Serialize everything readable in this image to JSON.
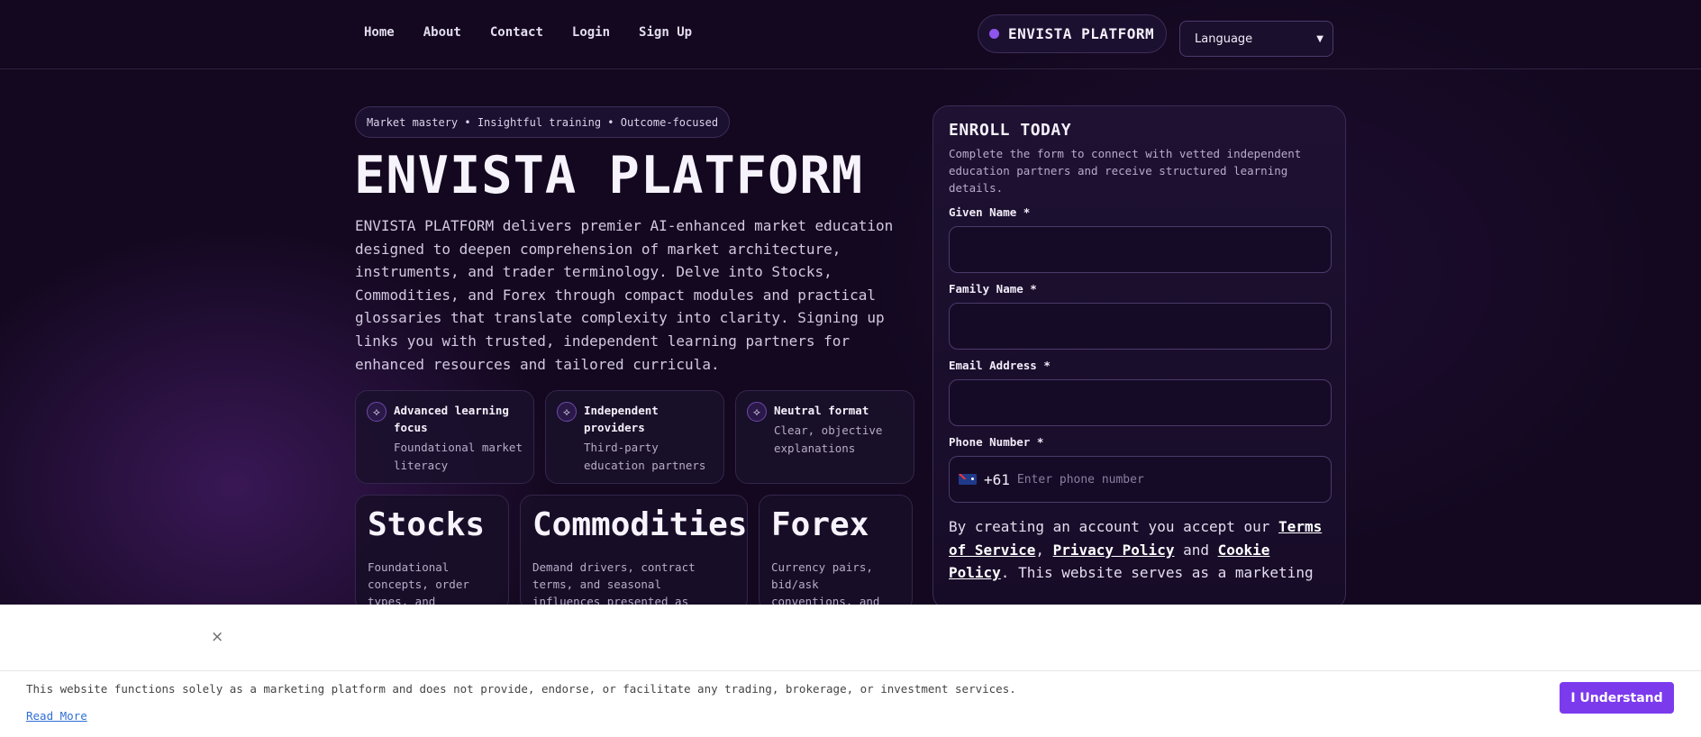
{
  "nav": {
    "items": [
      "Home",
      "About",
      "Contact",
      "Login",
      "Sign Up"
    ],
    "brand": "ENVISTA PLATFORM",
    "language_label": "Language"
  },
  "hero": {
    "tagline": "Market mastery • Insightful training • Outcome-focused",
    "title": "ENVISTA PLATFORM",
    "description": "ENVISTA PLATFORM delivers premier AI-enhanced market education designed to deepen comprehension of market architecture, instruments, and trader terminology. Delve into Stocks, Commodities, and Forex through compact modules and practical glossaries that translate complexity into clarity. Signing up links you with trusted, independent learning partners for enhanced resources and tailored curricula."
  },
  "features": [
    {
      "title": "Advanced learning focus",
      "sub": "Foundational market literacy"
    },
    {
      "title": "Independent providers",
      "sub": "Third-party education partners"
    },
    {
      "title": "Neutral format",
      "sub": "Clear, objective explanations"
    }
  ],
  "cards": [
    {
      "title": "Stocks",
      "desc": "Foundational concepts, order types, and"
    },
    {
      "title": "Commodities",
      "desc": "Demand drivers, contract terms, and seasonal influences presented as approachable"
    },
    {
      "title": "Forex",
      "desc": "Currency pairs, bid/ask conventions, and macro drivers"
    }
  ],
  "form": {
    "title": "ENROLL TODAY",
    "subtitle": "Complete the form to connect with vetted independent education partners and receive structured learning details.",
    "given_name_label": "Given Name *",
    "family_name_label": "Family Name *",
    "email_label": "Email Address *",
    "phone_label": "Phone Number *",
    "phone_code": "+61",
    "phone_placeholder": "Enter phone number",
    "terms_prefix": "By creating an account you accept our ",
    "terms_link": "Terms of Service",
    "terms_sep1": ", ",
    "privacy_link": "Privacy Policy",
    "terms_sep2": " and ",
    "cookie_link": "Cookie Policy",
    "terms_suffix": ". This website serves as a marketing"
  },
  "banner": {
    "close": "×",
    "text": "This website functions solely as a marketing platform and does not provide, endorse, or facilitate any trading, brokerage, or investment services.",
    "read_more": "Read More",
    "button": "I Understand"
  }
}
